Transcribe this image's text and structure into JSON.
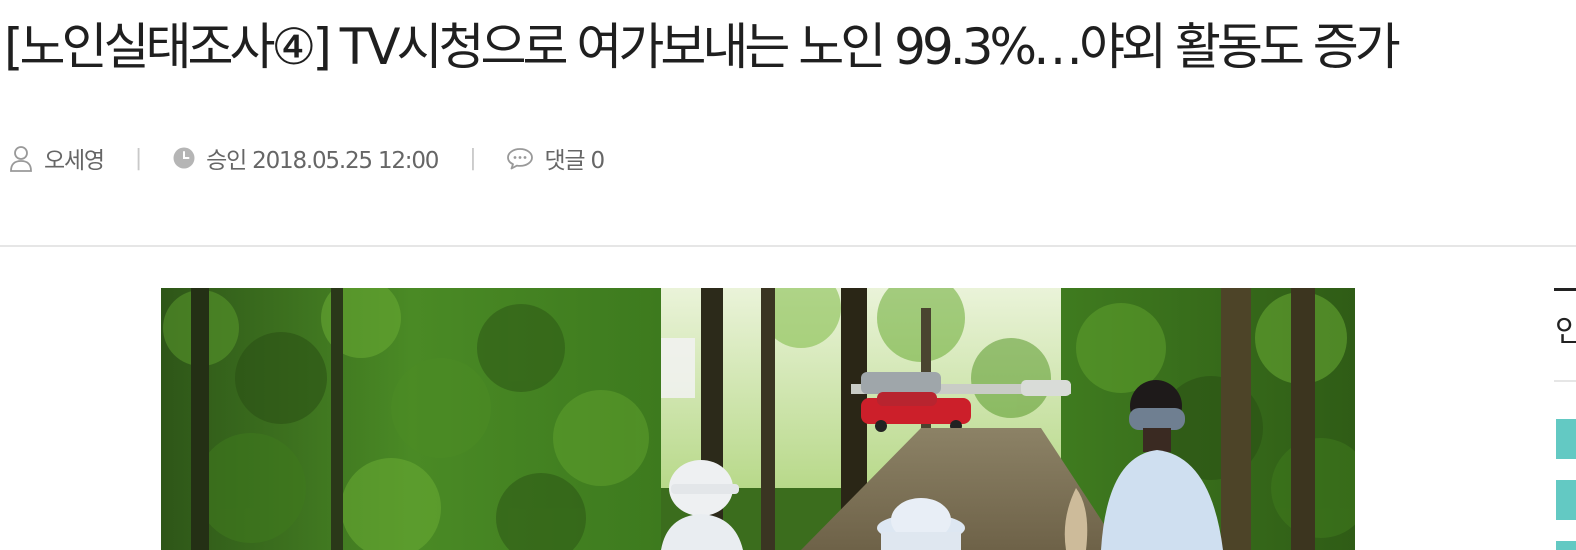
{
  "article": {
    "headline": "[노인실태조사④] TV시청으로 여가보내는 노인 99.3%…야외 활동도 증가",
    "meta": {
      "author": "오세영",
      "published_label": "승인 2018.05.25 12:00",
      "comments_label": "댓글 0"
    },
    "image": {
      "description_icon": "photo-elderly-walking-forest-path"
    }
  },
  "sidebar": {
    "clipped_heading_char": "인"
  },
  "icons": {
    "author": "user-icon",
    "published": "clock-icon",
    "comments": "speech-bubble-icon"
  },
  "colors": {
    "headline": "#1f1f1f",
    "meta_text": "#666666",
    "divider": "#e6e6e6",
    "sidebar_tab": "#63c9c3"
  }
}
